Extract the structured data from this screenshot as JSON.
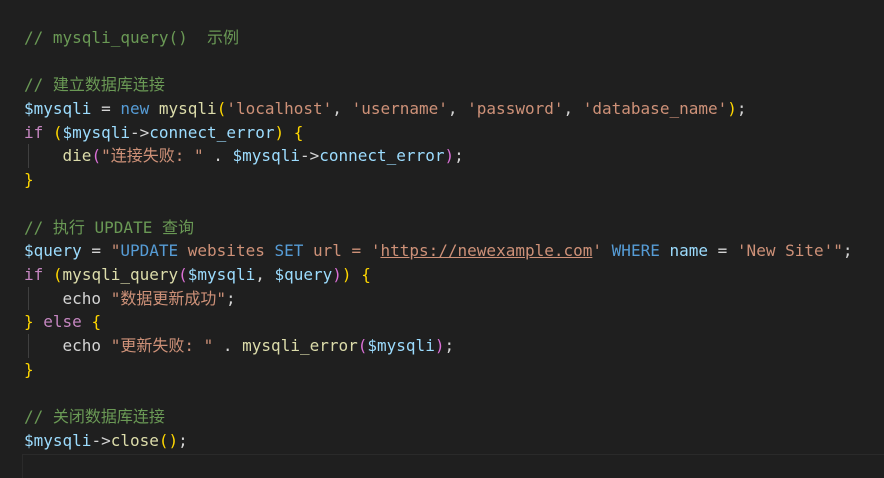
{
  "code": {
    "line1_comment": "// mysqli_query()  示例",
    "line3_comment": "// 建立数据库连接",
    "line4": {
      "var": "$mysqli",
      "assign": " = ",
      "new_kw": "new",
      "space": " ",
      "class": "mysqli",
      "paren_open": "(",
      "arg1": "'localhost'",
      "comma1": ", ",
      "arg2": "'username'",
      "comma2": ", ",
      "arg3": "'password'",
      "comma3": ", ",
      "arg4": "'database_name'",
      "paren_close": ")",
      "semi": ";"
    },
    "line5": {
      "if_kw": "if",
      "space": " ",
      "paren_open": "(",
      "var": "$mysqli",
      "arrow": "->",
      "prop": "connect_error",
      "paren_close": ")",
      "brace": " {"
    },
    "line6": {
      "indent": "    ",
      "fn": "die",
      "paren_open": "(",
      "str": "\"连接失败: \"",
      "concat": " . ",
      "var": "$mysqli",
      "arrow": "->",
      "prop": "connect_error",
      "paren_close": ")",
      "semi": ";"
    },
    "line7_brace": "}",
    "line9_comment": "// 执行 UPDATE 查询",
    "line10": {
      "var": "$query",
      "assign": " = ",
      "q_open": "\"",
      "sql_update": "UPDATE",
      "sql_table": " websites ",
      "sql_set": "SET",
      "sp1": " ",
      "sql_col": "url",
      "sql_eq": " = ",
      "sq1": "'",
      "url": "https://newexample.com",
      "sq2": "'",
      "sp2": " ",
      "sql_where": "WHERE",
      "sp3": " ",
      "sql_col2": "name",
      "sql_eq2": " = ",
      "sql_val": "'New Site'",
      "q_close": "\"",
      "semi": ";"
    },
    "line11": {
      "if_kw": "if",
      "space": " ",
      "paren_open": "(",
      "fn": "mysqli_query",
      "paren2_open": "(",
      "var1": "$mysqli",
      "comma": ", ",
      "var2": "$query",
      "paren2_close": ")",
      "paren_close": ")",
      "brace": " {"
    },
    "line12": {
      "indent": "    ",
      "echo": "echo",
      "space": " ",
      "str": "\"数据更新成功\"",
      "semi": ";"
    },
    "line13": {
      "close": "}",
      "space": " ",
      "else_kw": "else",
      "brace": " {"
    },
    "line14": {
      "indent": "    ",
      "echo": "echo",
      "space": " ",
      "str": "\"更新失败: \"",
      "concat": " . ",
      "fn": "mysqli_error",
      "paren_open": "(",
      "var": "$mysqli",
      "paren_close": ")",
      "semi": ";"
    },
    "line15_brace": "}",
    "line17_comment": "// 关闭数据库连接",
    "line18": {
      "var": "$mysqli",
      "arrow": "->",
      "method": "close",
      "parens": "()",
      "semi": ";"
    }
  },
  "colors": {
    "background": "#1f1f1f",
    "comment": "#6a9955",
    "variable": "#9cdcfe",
    "keyword": "#569cd6",
    "control": "#c586c0",
    "function": "#dcdcaa",
    "string": "#ce9178",
    "bracket_level1": "#ffd700",
    "bracket_level2": "#da70d6",
    "bracket_level3": "#179fff"
  }
}
